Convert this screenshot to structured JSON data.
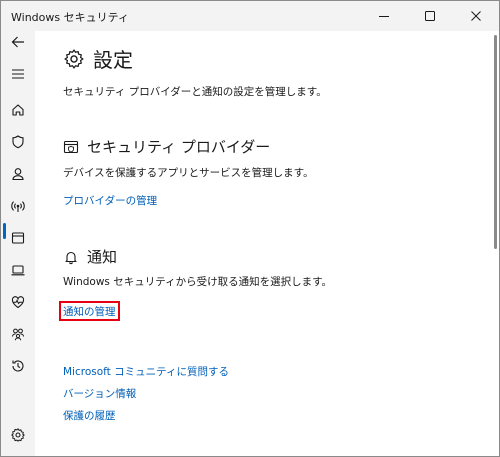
{
  "window": {
    "title": "Windows セキュリティ"
  },
  "sidebar": {
    "items": [
      {
        "icon": "back-arrow-icon"
      },
      {
        "icon": "menu-icon"
      },
      {
        "icon": "home-icon"
      },
      {
        "icon": "shield-icon"
      },
      {
        "icon": "person-icon"
      },
      {
        "icon": "wireless-icon",
        "active": true
      },
      {
        "icon": "app-browser-icon"
      },
      {
        "icon": "laptop-icon"
      },
      {
        "icon": "health-icon"
      },
      {
        "icon": "family-icon"
      },
      {
        "icon": "history-icon"
      },
      {
        "icon": "settings-icon"
      }
    ]
  },
  "page": {
    "title": "設定",
    "description": "セキュリティ プロバイダーと通知の設定を管理します。"
  },
  "security_provider": {
    "heading": "セキュリティ プロバイダー",
    "description": "デバイスを保護するアプリとサービスを管理します。",
    "link": "プロバイダーの管理"
  },
  "notifications": {
    "heading": "通知",
    "description": "Windows セキュリティから受け取る通知を選択します。",
    "link": "通知の管理"
  },
  "footer_links": [
    "Microsoft コミュニティに質問する",
    "バージョン情報",
    "保護の履歴"
  ],
  "colors": {
    "accent": "#005fb8",
    "highlight_border": "#e60012"
  }
}
